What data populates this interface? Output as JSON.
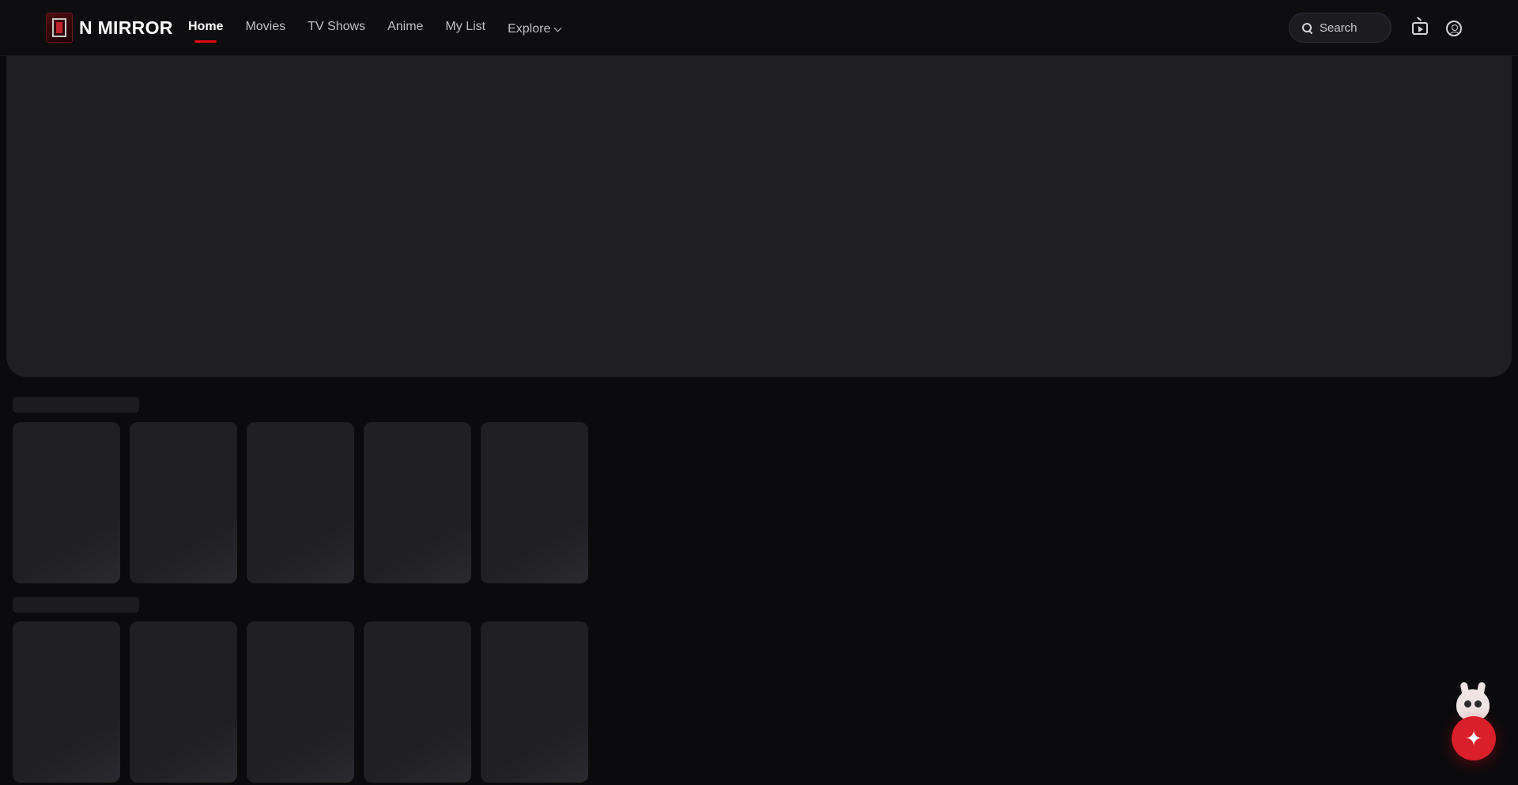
{
  "brand": {
    "name": "N MIRROR"
  },
  "nav": {
    "items": [
      {
        "label": "Home",
        "active": true
      },
      {
        "label": "Movies",
        "active": false
      },
      {
        "label": "TV Shows",
        "active": false
      },
      {
        "label": "Anime",
        "active": false
      },
      {
        "label": "My List",
        "active": false
      }
    ],
    "explore_label": "Explore"
  },
  "search": {
    "placeholder": "Search"
  },
  "header_icons": [
    "tv-icon",
    "user-icon"
  ],
  "colors": {
    "accent": "#e50914",
    "background": "#0b0b0d",
    "skeleton": "#1f1f24"
  },
  "fab": {
    "icon": "sparkle-icon"
  }
}
